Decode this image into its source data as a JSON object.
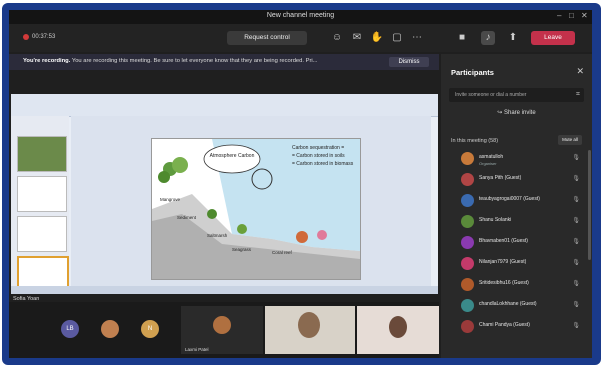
{
  "window": {
    "title": "New channel meeting"
  },
  "toolbar": {
    "timer": "00:37:53",
    "request_control": "Request control",
    "leave": "Leave"
  },
  "banner": {
    "lead": "You're recording.",
    "text": "You are recording this meeting. Be sure to let everyone know that they are being recorded. Pri...",
    "dismiss": "Dismiss"
  },
  "stage": {
    "presenter_name": "Sofia Yoan",
    "slide_labels": {
      "atmosphere": "Atmosphere Carbon",
      "legend1": "Carbon sequestration =",
      "legend2": "= Carbon stored in soils",
      "legend3": "= Carbon stored in biomass",
      "mangrove": "Mangrove",
      "seagrass": "Seagrass",
      "saltmarsh": "Saltmarsh",
      "coral": "Coral reef",
      "sediment": "Sediment"
    }
  },
  "gallery": {
    "tile_initials": [
      "LB",
      "N"
    ],
    "tile_names": [
      "Laxmi Patel",
      "",
      ""
    ]
  },
  "participants": {
    "title": "Participants",
    "invite_placeholder": "Invite someone or dial a number",
    "share_invite": "Share invite",
    "in_meeting": "In this meeting (58)",
    "mute_all": "Mute all",
    "people": [
      {
        "name": "asmatulloh",
        "sub": "Organiser",
        "color": "#c87a3a"
      },
      {
        "name": "Sanya Pith (Guest)",
        "sub": "",
        "color": "#b04545"
      },
      {
        "name": "teaubyagrogai0007 (Guest)",
        "sub": "",
        "color": "#3a6ab0"
      },
      {
        "name": "Shanu Solanki",
        "sub": "",
        "color": "#5a8a3a"
      },
      {
        "name": "Bhavnaben01 (Guest)",
        "sub": "",
        "color": "#8a3ab0"
      },
      {
        "name": "Nilanjan7979 (Guest)",
        "sub": "",
        "color": "#c43a6a"
      },
      {
        "name": "Sritidesibhu16 (Guest)",
        "sub": "",
        "color": "#b05a2a"
      },
      {
        "name": "chandlaLokhhane (Guest)",
        "sub": "",
        "color": "#3a8a8a"
      },
      {
        "name": "Chami Pandya (Guest)",
        "sub": "",
        "color": "#9a3a3a"
      }
    ]
  }
}
